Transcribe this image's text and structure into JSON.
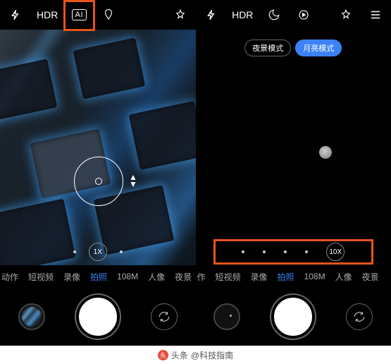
{
  "left": {
    "topbar": {
      "flash": "⚡",
      "hdr": "HDR",
      "ai": "AI",
      "filter_icon": "filter",
      "effects_icon": "effects"
    },
    "zoom": {
      "value": "1X"
    },
    "modes": [
      "动作",
      "短视频",
      "录像",
      "拍照",
      "108M",
      "人像",
      "夜景"
    ],
    "activeModeIndex": 3
  },
  "right": {
    "topbar": {
      "flash": "⚡",
      "hdr": "HDR",
      "moon_icon": "moon",
      "live_icon": "live",
      "effects_icon": "effects",
      "menu_icon": "menu"
    },
    "pills": [
      {
        "label": "夜景模式",
        "active": false
      },
      {
        "label": "月亮模式",
        "active": true
      }
    ],
    "zoom": {
      "value": "10X"
    },
    "modes": [
      "作",
      "短视频",
      "录像",
      "拍照",
      "108M",
      "人像",
      "夜景"
    ],
    "activeModeIndex": 3
  },
  "attribution": {
    "logo": "头",
    "prefix": "头条",
    "handle": "@科技指南"
  }
}
